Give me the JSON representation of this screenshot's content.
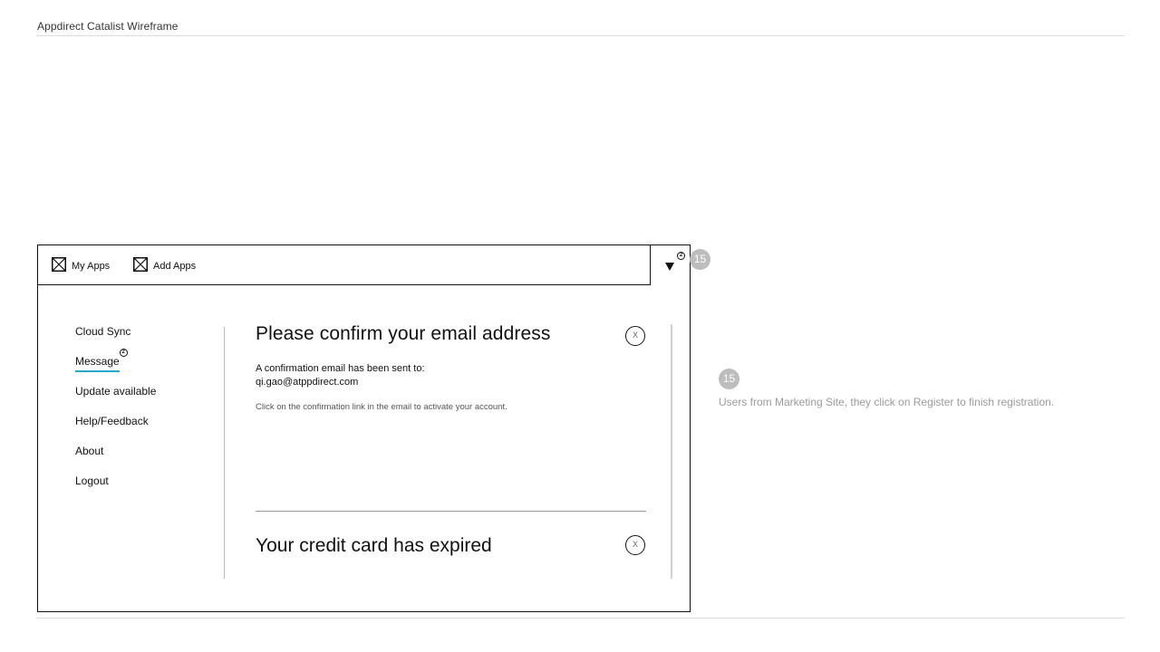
{
  "document": {
    "title": "Appdirect Catalist Wireframe"
  },
  "topbar": {
    "my_apps_label": "My Apps",
    "add_apps_label": "Add Apps",
    "menu_notification": "2"
  },
  "sidebar": {
    "items": [
      {
        "label": "Cloud Sync"
      },
      {
        "label": "Message",
        "active": true,
        "notification": "2"
      },
      {
        "label": "Update available"
      },
      {
        "label": "Help/Feedback"
      },
      {
        "label": "About"
      },
      {
        "label": "Logout"
      }
    ]
  },
  "notifications": [
    {
      "title": "Please confirm your email address",
      "line1": "A confirmation email has been sent to:",
      "email": "qi.gao@atppdirect.com",
      "hint": "Click on the confirmation link in the email to activate your account.",
      "close_label": "X"
    },
    {
      "title": "Your credit card has expired",
      "close_label": "X"
    }
  ],
  "annotations": {
    "badge_number": "15",
    "note": "Users from Marketing Site, they click on Register to finish registration."
  },
  "colors": {
    "accent_underline": "#29a4cf",
    "badge": "#bdbdbd",
    "annotation_text": "#9a9a9a"
  },
  "icons": {
    "app_placeholder": "image-placeholder-icon",
    "menu": "dropdown-triangle-icon",
    "close": "close-icon"
  }
}
